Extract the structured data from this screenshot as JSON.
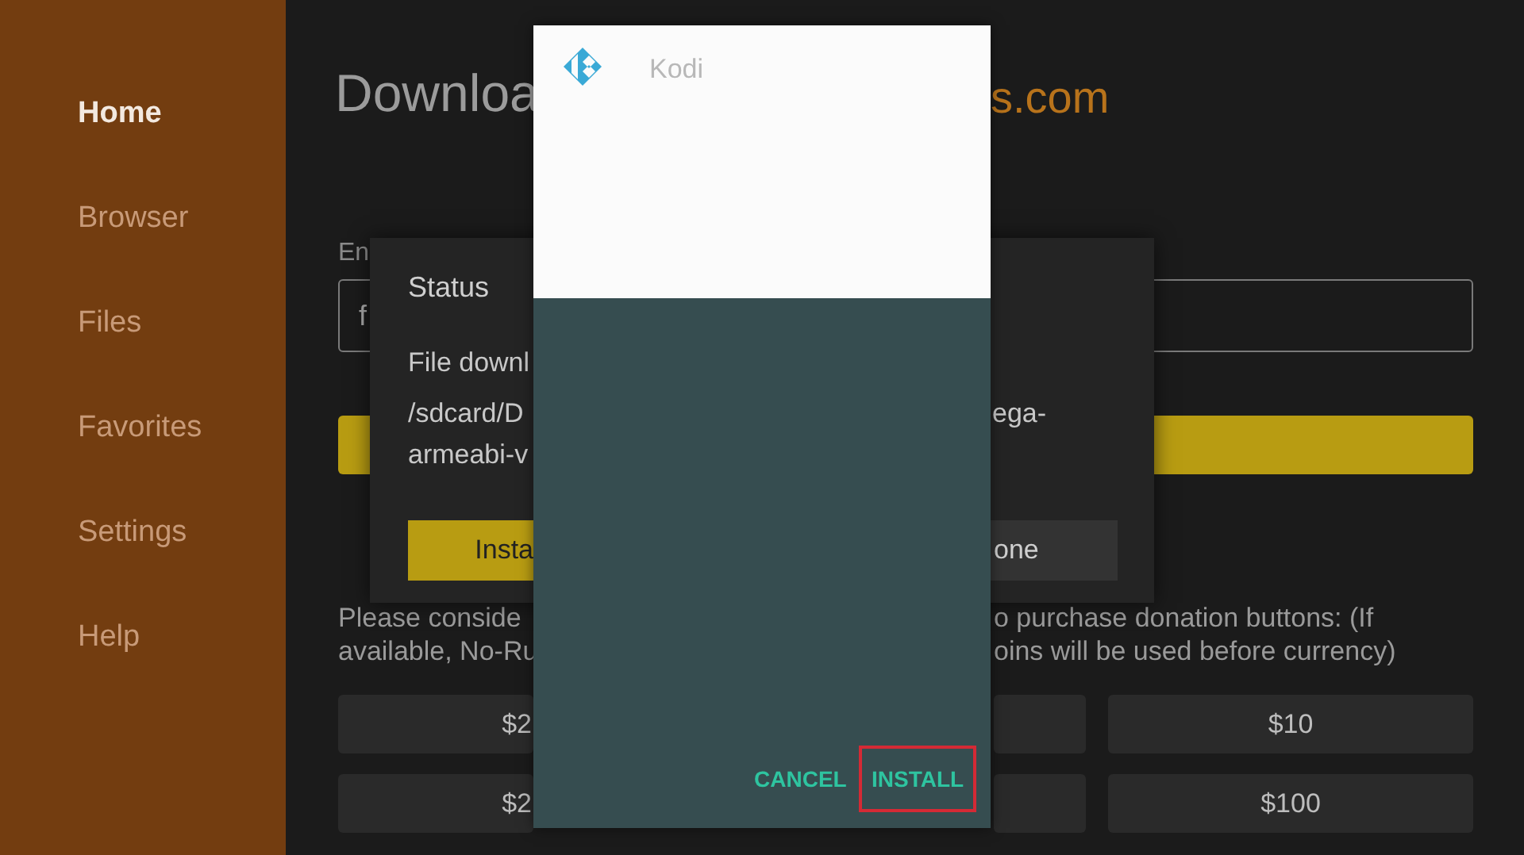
{
  "sidebar": {
    "items": [
      {
        "label": "Home",
        "selected": true
      },
      {
        "label": "Browser",
        "selected": false
      },
      {
        "label": "Files",
        "selected": false
      },
      {
        "label": "Favorites",
        "selected": false
      },
      {
        "label": "Settings",
        "selected": false
      },
      {
        "label": "Help",
        "selected": false
      }
    ]
  },
  "main": {
    "title_left": "Downloa",
    "title_right": "s.com",
    "field_label": "En",
    "field_value": "f",
    "note_left": [
      "Please conside",
      "available, No-Ru"
    ],
    "note_right": [
      "o purchase donation buttons: (If",
      "oins will be used before currency)"
    ],
    "donations_left": [
      "$2",
      "$2"
    ],
    "donations_right": [
      "$10",
      "$100"
    ]
  },
  "status_dialog": {
    "title": "Status",
    "message": "File downl",
    "path_left": [
      "/sdcard/D",
      "armeabi-v"
    ],
    "path_right": "ega-",
    "install": "Insta",
    "done": "one"
  },
  "install_dialog": {
    "title": "Kodi",
    "buttons": [
      {
        "label": "CANCEL",
        "highlighted": false
      },
      {
        "label": "INSTALL",
        "highlighted": true
      }
    ]
  }
}
